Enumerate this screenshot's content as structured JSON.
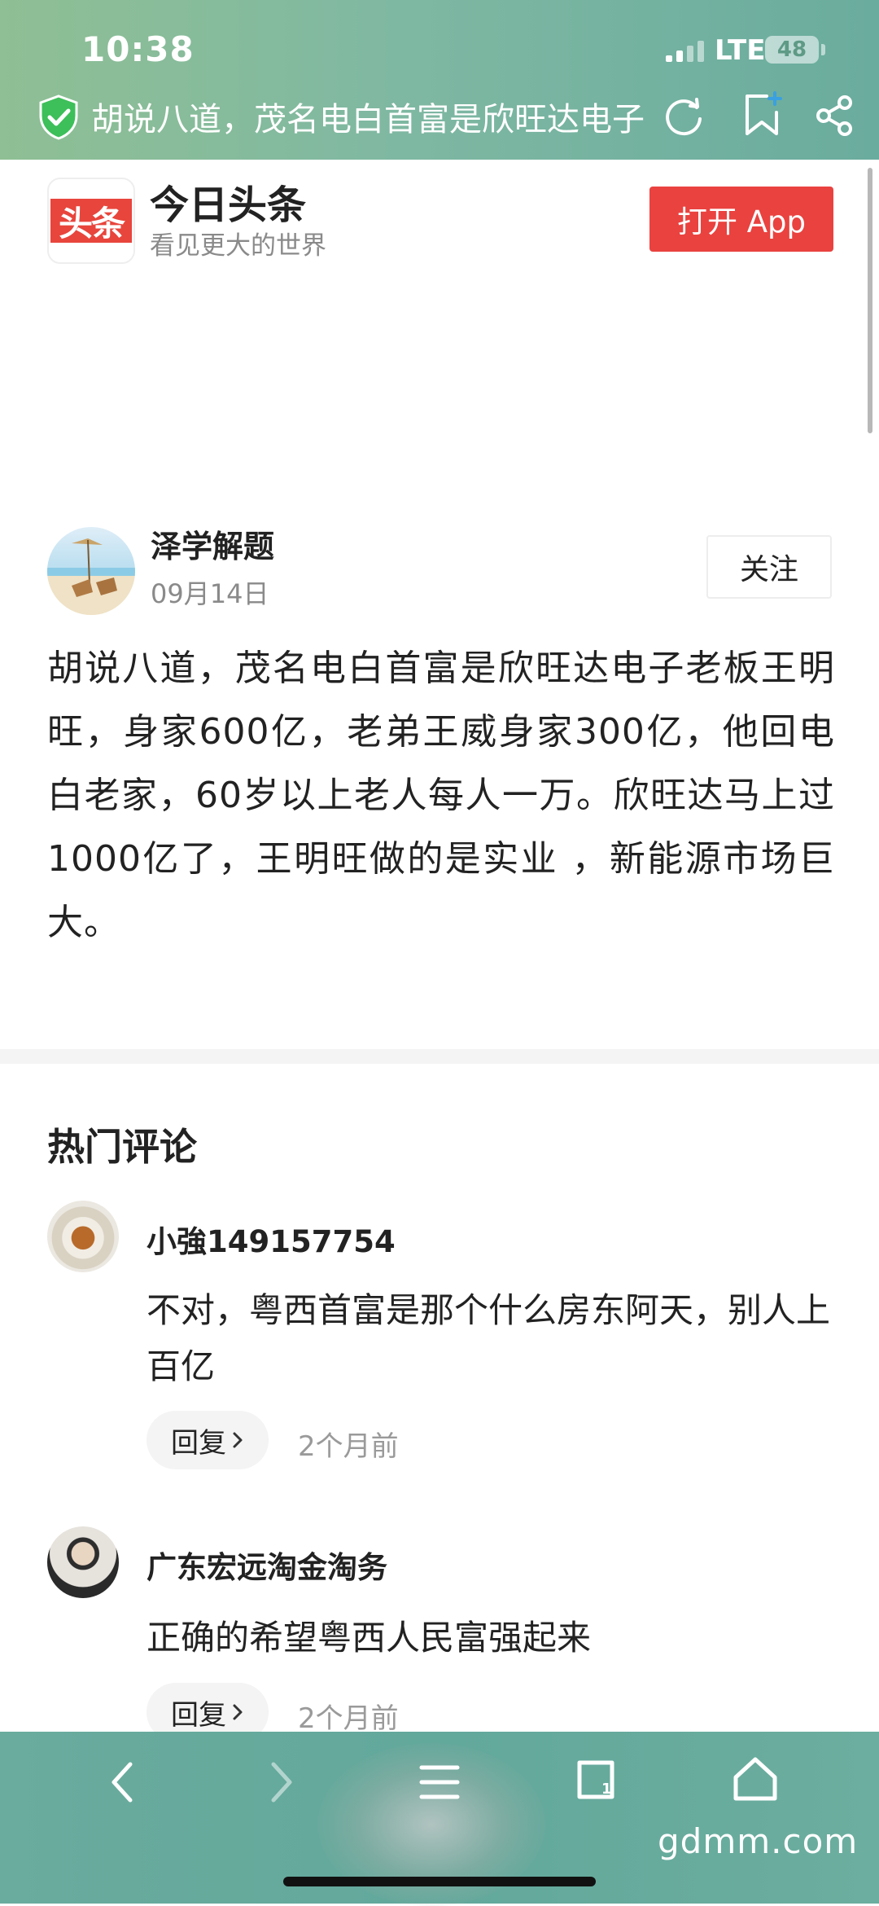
{
  "status_bar": {
    "time": "10:38",
    "network": "LTE",
    "battery": "48"
  },
  "browser": {
    "page_title": "胡说八道，茂名电白首富是欣旺达电子"
  },
  "app_banner": {
    "app_name": "今日头条",
    "slogan": "看见更大的世界",
    "logo_text": "头条",
    "open_button": "打开 App",
    "brand_color": "#e9423f"
  },
  "post": {
    "author": "泽学解题",
    "date": "09月14日",
    "follow_label": "关注",
    "content": "胡说八道，茂名电白首富是欣旺达电子老板王明旺，身家600亿，老弟王威身家300亿，他回电白老家，60岁以上老人每人一万。欣旺达马上过1000亿了，王明旺做的是实业 ，新能源市场巨大。"
  },
  "comments": {
    "heading": "热门评论",
    "items": [
      {
        "user": "小強149157754",
        "text": "不对，粤西首富是那个什么房东阿天，别人上百亿",
        "reply_label": "回复",
        "time": "2个月前"
      },
      {
        "user": "广东宏远淘金淘务",
        "text": "正确的希望粤西人民富强起来",
        "reply_label": "回复",
        "time": "2个月前"
      }
    ]
  },
  "watermark": "gdmm.com"
}
